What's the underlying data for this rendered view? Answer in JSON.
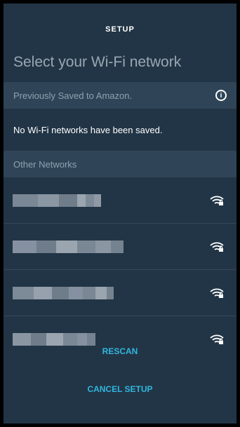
{
  "header": {
    "title": "SETUP"
  },
  "subtitle": "Select your Wi-Fi network",
  "saved_section": {
    "label": "Previously Saved to Amazon.",
    "info_icon": "info-icon"
  },
  "saved_empty_text": "No Wi-Fi networks have been saved.",
  "other_section": {
    "label": "Other Networks"
  },
  "networks": [
    {
      "icon": "wifi-lock-icon"
    },
    {
      "icon": "wifi-lock-icon"
    },
    {
      "icon": "wifi-lock-icon"
    },
    {
      "icon": "wifi-lock-icon"
    }
  ],
  "actions": {
    "rescan": "RESCAN",
    "cancel": "CANCEL SETUP"
  },
  "colors": {
    "background": "#223546",
    "section_bar": "#2f4557",
    "accent": "#31b6e0",
    "text": "#ffffff"
  }
}
